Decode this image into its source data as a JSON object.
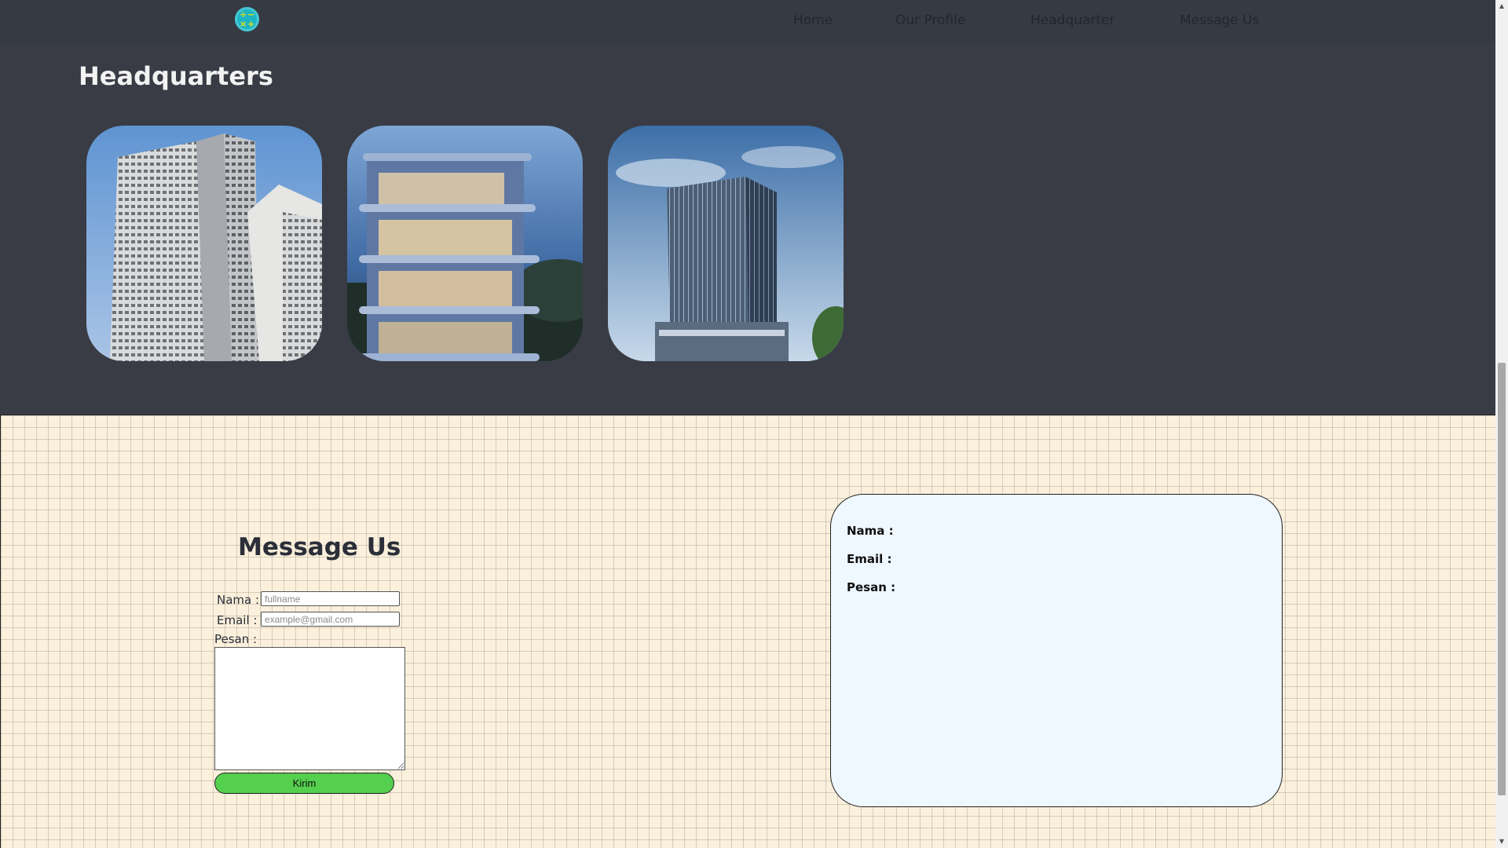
{
  "nav": {
    "items": [
      {
        "label": "Home"
      },
      {
        "label": "Our Profile"
      },
      {
        "label": "Headquarter"
      },
      {
        "label": "Message Us"
      }
    ]
  },
  "logo": {
    "glyphs": [
      "÷",
      "−",
      "×",
      "+"
    ]
  },
  "headquarters": {
    "title": "Headquarters",
    "cards": [
      {
        "name": "apartment-tower-photo"
      },
      {
        "name": "balcony-villa-photo"
      },
      {
        "name": "glass-office-tower-photo"
      }
    ]
  },
  "message_form": {
    "title": "Message Us",
    "nama_label": "Nama :",
    "nama_placeholder": "fullname",
    "email_label": "Email  :",
    "email_placeholder": "example@gmail.com",
    "pesan_label": "Pesan :",
    "submit_label": "Kirim"
  },
  "result_card": {
    "nama_label": "Nama :",
    "email_label": "Email :",
    "pesan_label": "Pesan :"
  },
  "colors": {
    "header_bg": "#393c45",
    "nav_text": "#23262d",
    "message_bg": "#fbf0dc",
    "submit_green": "#55cf4e",
    "card_bg": "#eff7ff",
    "logo_teal": "#1fb4c4"
  }
}
